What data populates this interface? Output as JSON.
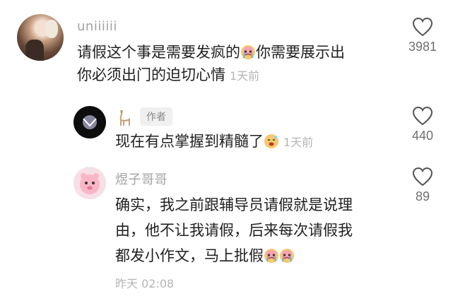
{
  "comments": [
    {
      "username": "uniiiiii",
      "line1": "请假这个事是需要发疯的",
      "line1b": "你需要展示出",
      "line2": "你必须出门的迫切心情",
      "timestamp": "1天前",
      "likes": "3981"
    },
    {
      "author_badge": "作者",
      "text": "现在有点掌握到精髓了",
      "timestamp": "1天前",
      "likes": "440"
    },
    {
      "username": "煜子哥哥",
      "line1": "确实，我之前跟辅导员请假就是说理",
      "line2": "由，他不让我请假，后来每次请假我",
      "line3": "都发小作文，马上批假",
      "timestamp": "昨天 02:08",
      "likes": "89"
    }
  ],
  "icons": {
    "like": "heart-outline-icon",
    "cry_emoji": "crying-face-emoji",
    "smirk_emoji": "sweat-smile-emoji",
    "llama": "llama-icon"
  }
}
